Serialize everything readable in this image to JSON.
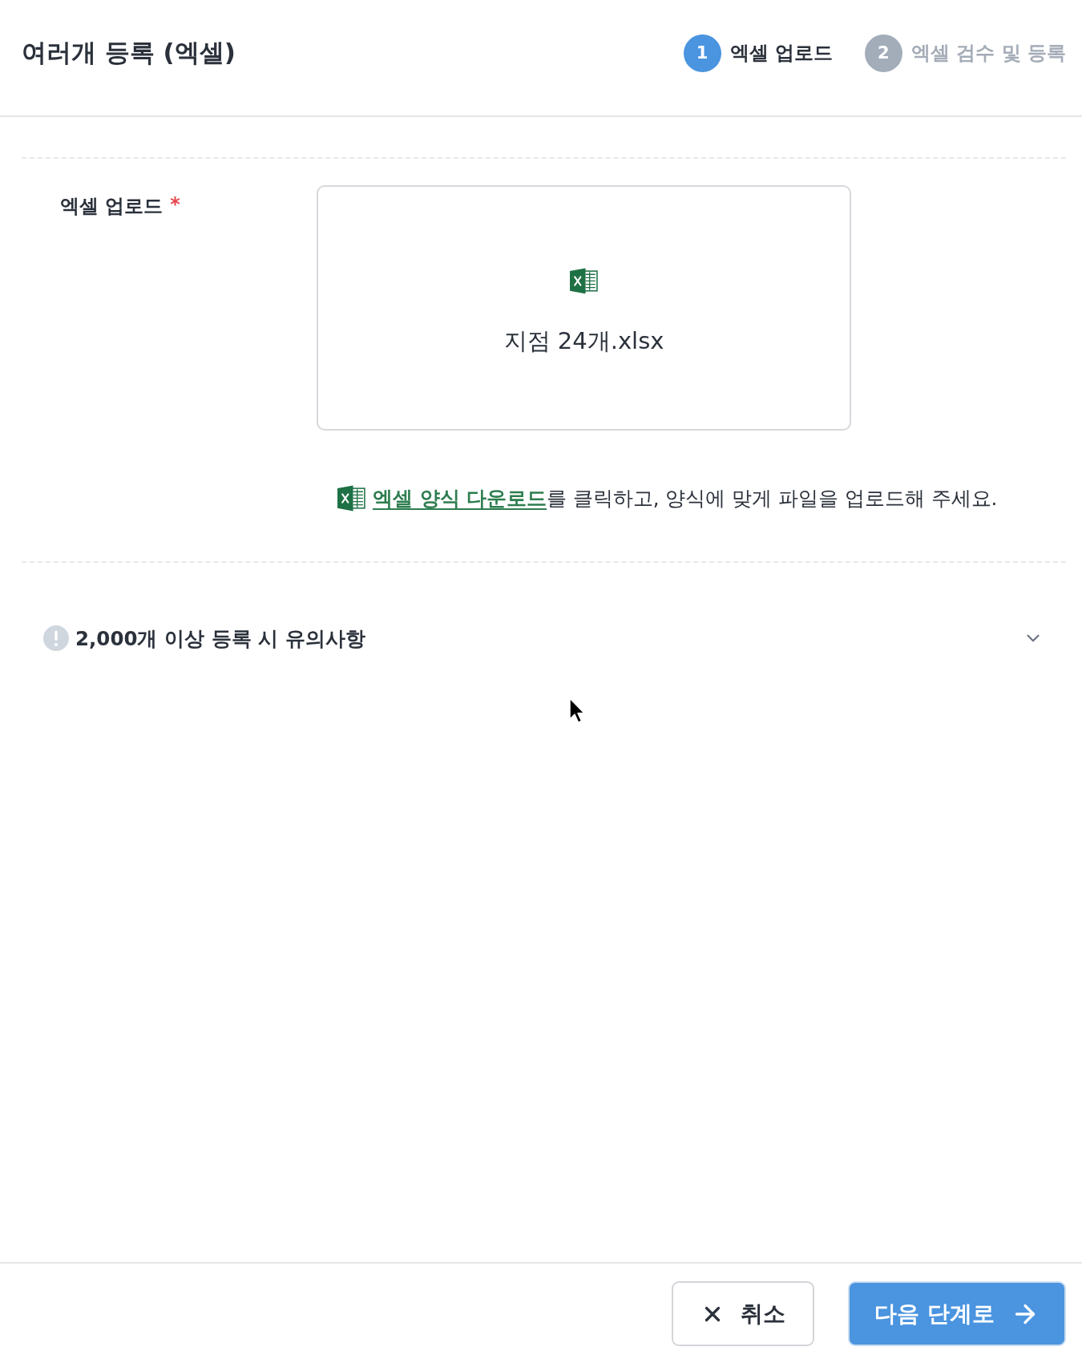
{
  "dialog": {
    "title": "여러개 등록 (엑셀)"
  },
  "steps": [
    {
      "number": "1",
      "label": "엑셀 업로드",
      "selected": true
    },
    {
      "number": "2",
      "label": "엑셀 검수 및 등록",
      "selected": false
    }
  ],
  "upload": {
    "label": "엑셀 업로드",
    "required_mark": "*",
    "file_name": "지점 24개.xlsx"
  },
  "hint": {
    "link": "엑셀 양식 다운로드",
    "text": "를 클릭하고, 양식에 맞게 파일을 업로드해 주세요."
  },
  "notice": {
    "title": "2,000개 이상 등록 시 유의사항",
    "expanded": false
  },
  "footer": {
    "buttons": [
      {
        "kind": "secondary",
        "label": "취소"
      },
      {
        "kind": "primary",
        "label": "다음 단계로"
      }
    ]
  }
}
